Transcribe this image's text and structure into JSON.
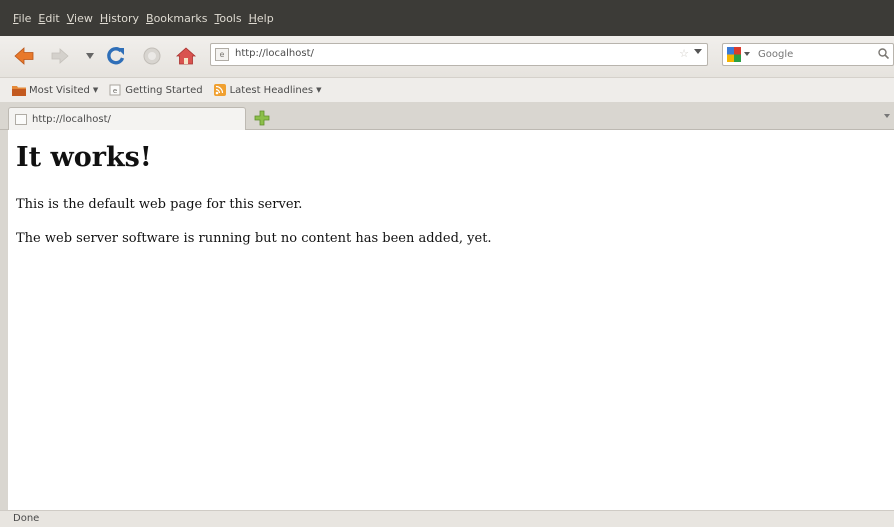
{
  "menubar": {
    "items": [
      "File",
      "Edit",
      "View",
      "History",
      "Bookmarks",
      "Tools",
      "Help"
    ]
  },
  "navbar": {
    "url": "http://localhost/",
    "search_placeholder": "Google"
  },
  "bookmarks": {
    "most_visited": "Most Visited",
    "getting_started": "Getting Started",
    "latest_headlines": "Latest Headlines"
  },
  "tab": {
    "title": "http://localhost/"
  },
  "page": {
    "heading": "It works!",
    "p1": "This is the default web page for this server.",
    "p2": "The web server software is running but no content has been added, yet."
  },
  "status": {
    "text": "Done"
  },
  "colors": {
    "menubar_bg": "#3c3b37",
    "back_arrow": "#e8792b",
    "reload": "#2f6fb8",
    "home": "#d9534f",
    "rss": "#f0a030"
  },
  "icons": [
    "back-icon",
    "forward-icon",
    "history-dropdown-icon",
    "reload-icon",
    "stop-icon",
    "home-icon",
    "site-identity-icon",
    "bookmark-star-icon",
    "search-engine-icon",
    "search-icon",
    "new-tab-icon",
    "tab-list-icon",
    "rss-icon"
  ]
}
